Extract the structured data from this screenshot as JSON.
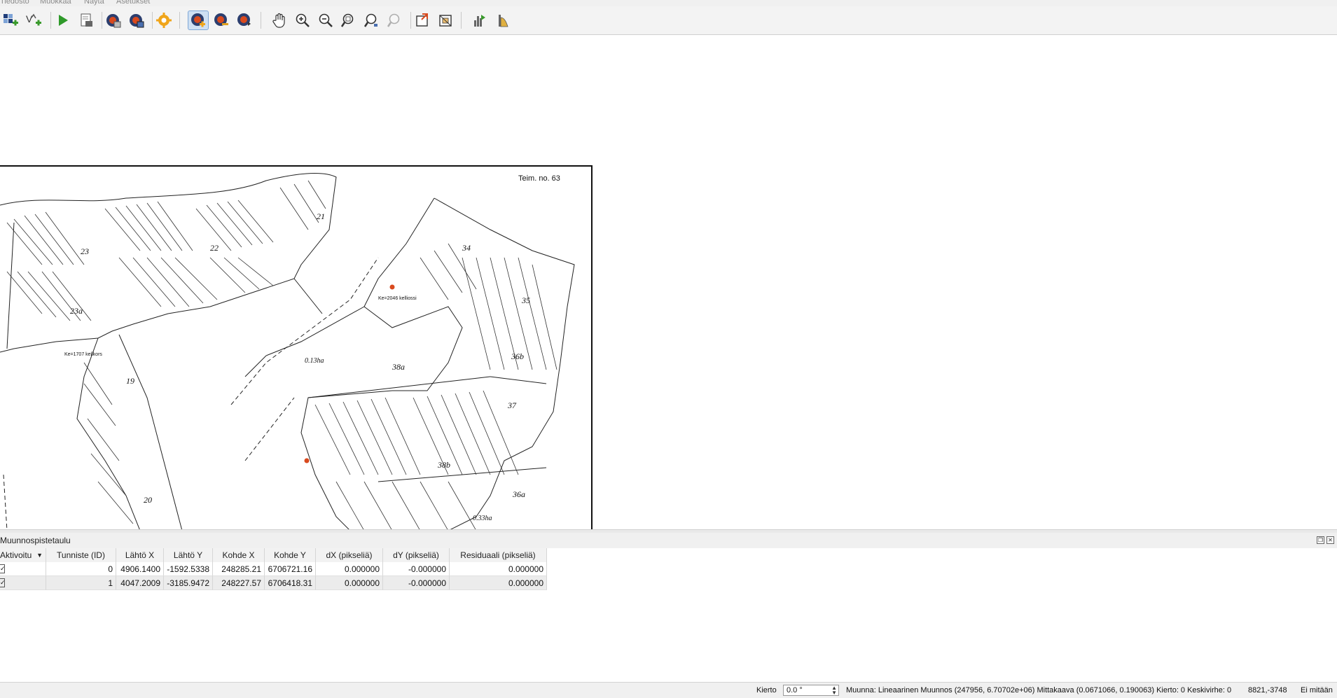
{
  "menu": [
    "Tiedosto",
    "Muokkaa",
    "Näytä",
    "Asetukset"
  ],
  "toolbar": {
    "icons": [
      "open-raster-icon",
      "open-vector-icon",
      "start-georeferencing-icon",
      "generate-gdal-script-icon",
      "load-gcp-points-icon",
      "save-gcp-points-icon",
      "transformation-settings-icon",
      "add-point-icon",
      "delete-point-icon",
      "move-point-icon",
      "pan-icon",
      "zoom-in-icon",
      "zoom-out-icon",
      "zoom-to-layer-icon",
      "zoom-last-icon",
      "zoom-next-icon",
      "link-georeferencer-icon",
      "link-qgis-icon",
      "histogram-stretch-icon",
      "local-histogram-icon"
    ]
  },
  "map": {
    "header_text": "Teim. no. 63",
    "parcel_labels": [
      "21",
      "22",
      "23",
      "23a",
      "34",
      "35",
      "36a",
      "36b",
      "37",
      "38a",
      "38b",
      "19",
      "20",
      "0.13ha",
      "0.33ha"
    ],
    "annotation_left": "Ke=1707 kelikors",
    "annotation_right": "Ke=2046 kelliossi"
  },
  "dock": {
    "title": "Muunnospistetaulu"
  },
  "table": {
    "columns": [
      "Aktivoitu",
      "Tunniste (ID)",
      "Lähtö X",
      "Lähtö Y",
      "Kohde X",
      "Kohde Y",
      "dX (pikseliä)",
      "dY (pikseliä)",
      "Residuaali (pikseliä)"
    ],
    "rows": [
      {
        "active": "✓",
        "id": "0",
        "src_x": "4906.1400",
        "src_y": "-1592.5338",
        "dst_x": "248285.21",
        "dst_y": "6706721.16",
        "dx": "0.000000",
        "dy": "-0.000000",
        "residual": "0.000000"
      },
      {
        "active": "✓",
        "id": "1",
        "src_x": "4047.2009",
        "src_y": "-3185.9472",
        "dst_x": "248227.57",
        "dst_y": "6706418.31",
        "dx": "0.000000",
        "dy": "-0.000000",
        "residual": "0.000000"
      }
    ]
  },
  "status": {
    "rotation_label": "Kierto",
    "rotation_value": "0.0 °",
    "transform_text": "Muunna: Lineaarinen Muunnos (247956, 6.70702e+06) Mittakaava (0.0671066, 0.190063) Kierto: 0 Keskivirhe: 0",
    "coordinates": "8821,-3748",
    "crs_text": "Ei mitään"
  },
  "colors": {
    "toolbar_bg": "#f3f3f3",
    "active_tool": "#cfe0f3",
    "accent_blue": "#1f5fae",
    "gcp_red": "#d94a1e"
  }
}
